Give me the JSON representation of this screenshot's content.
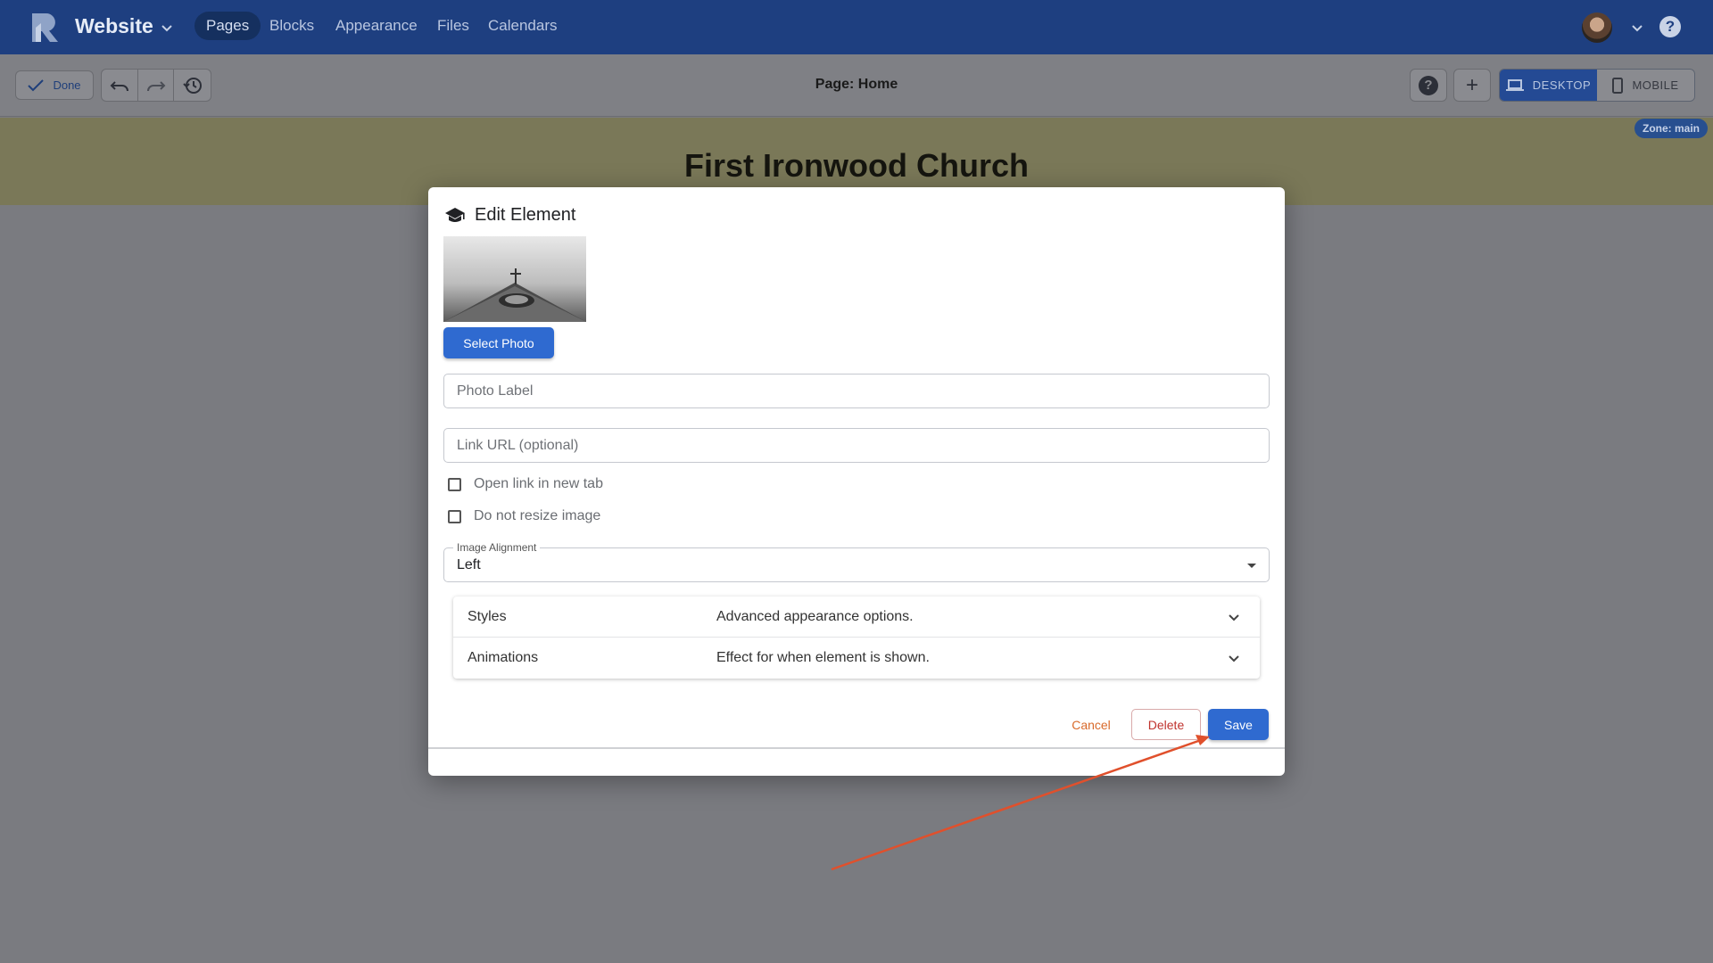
{
  "app": {
    "title": "Website",
    "nav": [
      {
        "label": "Pages",
        "active": true
      },
      {
        "label": "Blocks",
        "active": false
      },
      {
        "label": "Appearance",
        "active": false
      },
      {
        "label": "Files",
        "active": false
      },
      {
        "label": "Calendars",
        "active": false
      }
    ],
    "help_glyph": "?"
  },
  "toolbar": {
    "done_label": "Done",
    "page_label": "Page: Home",
    "help_glyph": "?",
    "add_glyph": "+",
    "desktop_label": "DESKTOP",
    "mobile_label": "MOBILE"
  },
  "canvas": {
    "hero_title": "First Ironwood Church",
    "zone_badge": "Zone: main"
  },
  "dialog": {
    "title": "Edit Element",
    "select_photo_label": "Select Photo",
    "photo_label_placeholder": "Photo Label",
    "link_url_placeholder": "Link URL (optional)",
    "checkboxes": [
      {
        "label": "Open link in new tab",
        "checked": false
      },
      {
        "label": "Do not resize image",
        "checked": false
      }
    ],
    "alignment": {
      "legend": "Image Alignment",
      "value": "Left"
    },
    "accordion": [
      {
        "name": "Styles",
        "description": "Advanced appearance options."
      },
      {
        "name": "Animations",
        "description": "Effect for when element is shown."
      }
    ],
    "cancel_label": "Cancel",
    "delete_label": "Delete",
    "save_label": "Save"
  },
  "colors": {
    "nav_bg": "#1e3f80",
    "primary": "#2f6ad0",
    "cancel": "#d86a2b",
    "delete": "#c0332e",
    "annotation_arrow": "#e0502c"
  },
  "icons": {
    "logo": "r-logo-icon",
    "dropdown": "chevron-down-icon",
    "done": "check-icon",
    "undo": "undo-icon",
    "redo": "redo-icon",
    "history": "history-icon",
    "help": "help-circle-icon",
    "add": "plus-icon",
    "desktop": "laptop-icon",
    "mobile": "phone-icon",
    "dialog": "graduation-cap-icon"
  }
}
